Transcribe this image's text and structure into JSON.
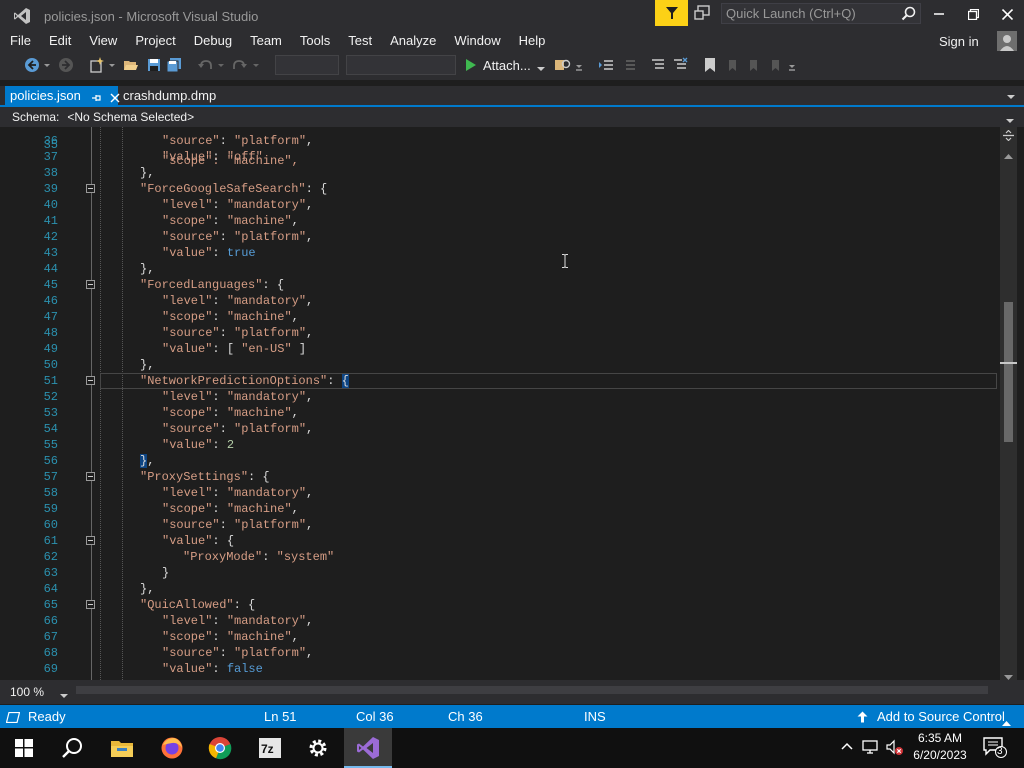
{
  "window": {
    "title": "policies.json - Microsoft Visual Studio",
    "quick_launch_placeholder": "Quick Launch (Ctrl+Q)"
  },
  "menu": [
    "File",
    "Edit",
    "View",
    "Project",
    "Debug",
    "Team",
    "Tools",
    "Test",
    "Analyze",
    "Window",
    "Help"
  ],
  "account": {
    "signin": "Sign in"
  },
  "toolbar": {
    "attach_label": "Attach..."
  },
  "tabs": [
    {
      "label": "policies.json",
      "active": true
    },
    {
      "label": "crashdump.dmp",
      "active": false
    }
  ],
  "schema": {
    "label": "Schema:",
    "value": "<No Schema Selected>"
  },
  "editor": {
    "first_line_fragment": "\"scope\": \"machine\",",
    "lines": [
      {
        "n": "36",
        "indent": 1,
        "tokens": [
          [
            "s",
            "\"source\""
          ],
          [
            "p",
            ": "
          ],
          [
            "s",
            "\"platform\""
          ],
          [
            "p",
            ","
          ]
        ]
      },
      {
        "n": "37",
        "indent": 1,
        "tokens": [
          [
            "s",
            "\"value\""
          ],
          [
            "p",
            ": "
          ],
          [
            "s",
            "\"off\""
          ]
        ]
      },
      {
        "n": "38",
        "indent": 0,
        "tokens": [
          [
            "p",
            "},"
          ]
        ]
      },
      {
        "n": "39",
        "indent": 0,
        "fold": true,
        "tokens": [
          [
            "s",
            "\"ForceGoogleSafeSearch\""
          ],
          [
            "p",
            ": {"
          ]
        ]
      },
      {
        "n": "40",
        "indent": 1,
        "tokens": [
          [
            "s",
            "\"level\""
          ],
          [
            "p",
            ": "
          ],
          [
            "s",
            "\"mandatory\""
          ],
          [
            "p",
            ","
          ]
        ]
      },
      {
        "n": "41",
        "indent": 1,
        "tokens": [
          [
            "s",
            "\"scope\""
          ],
          [
            "p",
            ": "
          ],
          [
            "s",
            "\"machine\""
          ],
          [
            "p",
            ","
          ]
        ]
      },
      {
        "n": "42",
        "indent": 1,
        "tokens": [
          [
            "s",
            "\"source\""
          ],
          [
            "p",
            ": "
          ],
          [
            "s",
            "\"platform\""
          ],
          [
            "p",
            ","
          ]
        ]
      },
      {
        "n": "43",
        "indent": 1,
        "tokens": [
          [
            "s",
            "\"value\""
          ],
          [
            "p",
            ": "
          ],
          [
            "kw",
            "true"
          ]
        ]
      },
      {
        "n": "44",
        "indent": 0,
        "tokens": [
          [
            "p",
            "},"
          ]
        ]
      },
      {
        "n": "45",
        "indent": 0,
        "fold": true,
        "tokens": [
          [
            "s",
            "\"ForcedLanguages\""
          ],
          [
            "p",
            ": {"
          ]
        ]
      },
      {
        "n": "46",
        "indent": 1,
        "tokens": [
          [
            "s",
            "\"level\""
          ],
          [
            "p",
            ": "
          ],
          [
            "s",
            "\"mandatory\""
          ],
          [
            "p",
            ","
          ]
        ]
      },
      {
        "n": "47",
        "indent": 1,
        "tokens": [
          [
            "s",
            "\"scope\""
          ],
          [
            "p",
            ": "
          ],
          [
            "s",
            "\"machine\""
          ],
          [
            "p",
            ","
          ]
        ]
      },
      {
        "n": "48",
        "indent": 1,
        "tokens": [
          [
            "s",
            "\"source\""
          ],
          [
            "p",
            ": "
          ],
          [
            "s",
            "\"platform\""
          ],
          [
            "p",
            ","
          ]
        ]
      },
      {
        "n": "49",
        "indent": 1,
        "tokens": [
          [
            "s",
            "\"value\""
          ],
          [
            "p",
            ": [ "
          ],
          [
            "s",
            "\"en-US\""
          ],
          [
            "p",
            " ]"
          ]
        ]
      },
      {
        "n": "50",
        "indent": 0,
        "tokens": [
          [
            "p",
            "},"
          ]
        ]
      },
      {
        "n": "51",
        "indent": 0,
        "fold": true,
        "current": true,
        "tokens": [
          [
            "s",
            "\"NetworkPredictionOptions\""
          ],
          [
            "p",
            ": "
          ],
          [
            "hl",
            "{"
          ]
        ]
      },
      {
        "n": "52",
        "indent": 1,
        "tokens": [
          [
            "s",
            "\"level\""
          ],
          [
            "p",
            ": "
          ],
          [
            "s",
            "\"mandatory\""
          ],
          [
            "p",
            ","
          ]
        ]
      },
      {
        "n": "53",
        "indent": 1,
        "tokens": [
          [
            "s",
            "\"scope\""
          ],
          [
            "p",
            ": "
          ],
          [
            "s",
            "\"machine\""
          ],
          [
            "p",
            ","
          ]
        ]
      },
      {
        "n": "54",
        "indent": 1,
        "tokens": [
          [
            "s",
            "\"source\""
          ],
          [
            "p",
            ": "
          ],
          [
            "s",
            "\"platform\""
          ],
          [
            "p",
            ","
          ]
        ]
      },
      {
        "n": "55",
        "indent": 1,
        "tokens": [
          [
            "s",
            "\"value\""
          ],
          [
            "p",
            ": "
          ],
          [
            "num",
            "2"
          ]
        ]
      },
      {
        "n": "56",
        "indent": 0,
        "tokens": [
          [
            "hl",
            "}"
          ],
          [
            "p",
            ","
          ]
        ]
      },
      {
        "n": "57",
        "indent": 0,
        "fold": true,
        "tokens": [
          [
            "s",
            "\"ProxySettings\""
          ],
          [
            "p",
            ": {"
          ]
        ]
      },
      {
        "n": "58",
        "indent": 1,
        "tokens": [
          [
            "s",
            "\"level\""
          ],
          [
            "p",
            ": "
          ],
          [
            "s",
            "\"mandatory\""
          ],
          [
            "p",
            ","
          ]
        ]
      },
      {
        "n": "59",
        "indent": 1,
        "tokens": [
          [
            "s",
            "\"scope\""
          ],
          [
            "p",
            ": "
          ],
          [
            "s",
            "\"machine\""
          ],
          [
            "p",
            ","
          ]
        ]
      },
      {
        "n": "60",
        "indent": 1,
        "tokens": [
          [
            "s",
            "\"source\""
          ],
          [
            "p",
            ": "
          ],
          [
            "s",
            "\"platform\""
          ],
          [
            "p",
            ","
          ]
        ]
      },
      {
        "n": "61",
        "indent": 1,
        "fold": true,
        "tokens": [
          [
            "s",
            "\"value\""
          ],
          [
            "p",
            ": {"
          ]
        ]
      },
      {
        "n": "62",
        "indent": 2,
        "tokens": [
          [
            "s",
            "\"ProxyMode\""
          ],
          [
            "p",
            ": "
          ],
          [
            "s",
            "\"system\""
          ]
        ]
      },
      {
        "n": "63",
        "indent": 1,
        "tokens": [
          [
            "p",
            "}"
          ]
        ]
      },
      {
        "n": "64",
        "indent": 0,
        "tokens": [
          [
            "p",
            "},"
          ]
        ]
      },
      {
        "n": "65",
        "indent": 0,
        "fold": true,
        "tokens": [
          [
            "s",
            "\"QuicAllowed\""
          ],
          [
            "p",
            ": {"
          ]
        ]
      },
      {
        "n": "66",
        "indent": 1,
        "tokens": [
          [
            "s",
            "\"level\""
          ],
          [
            "p",
            ": "
          ],
          [
            "s",
            "\"mandatory\""
          ],
          [
            "p",
            ","
          ]
        ]
      },
      {
        "n": "67",
        "indent": 1,
        "tokens": [
          [
            "s",
            "\"scope\""
          ],
          [
            "p",
            ": "
          ],
          [
            "s",
            "\"machine\""
          ],
          [
            "p",
            ","
          ]
        ]
      },
      {
        "n": "68",
        "indent": 1,
        "tokens": [
          [
            "s",
            "\"source\""
          ],
          [
            "p",
            ": "
          ],
          [
            "s",
            "\"platform\""
          ],
          [
            "p",
            ","
          ]
        ]
      },
      {
        "n": "69",
        "indent": 1,
        "tokens": [
          [
            "s",
            "\"value\""
          ],
          [
            "p",
            ": "
          ],
          [
            "kw",
            "false"
          ]
        ]
      }
    ]
  },
  "zoom": "100 %",
  "status": {
    "state": "Ready",
    "ln": "Ln 51",
    "col": "Col 36",
    "ch": "Ch 36",
    "mode": "INS",
    "source_control": "Add to Source Control"
  },
  "taskbar": {
    "time": "6:35 AM",
    "date": "6/20/2023",
    "notifications": "3",
    "apps": [
      "start-icon",
      "search-icon",
      "file-explorer-icon",
      "firefox-icon",
      "chrome-icon",
      "7zip-icon",
      "settings-icon",
      "visual-studio-icon"
    ]
  },
  "colors": {
    "accent": "#007acc",
    "string": "#d69d85",
    "keyword": "#569cd6",
    "number": "#b5cea8",
    "line_number": "#2b91af"
  }
}
